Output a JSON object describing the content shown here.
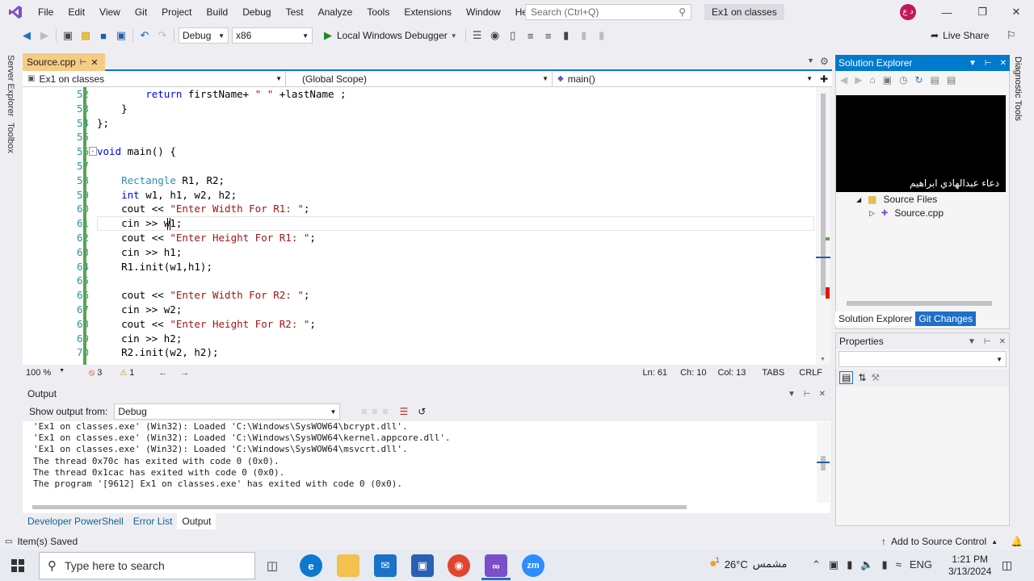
{
  "menu": [
    "File",
    "Edit",
    "View",
    "Git",
    "Project",
    "Build",
    "Debug",
    "Test",
    "Analyze",
    "Tools",
    "Extensions",
    "Window",
    "Help"
  ],
  "search": {
    "placeholder": "Search (Ctrl+Q)"
  },
  "solution_title": "Ex1 on classes",
  "avatar_initials": "د ع",
  "toolbar": {
    "config": "Debug",
    "platform": "x86",
    "run_label": "Local Windows Debugger",
    "live_share": "Live Share"
  },
  "left_rail": [
    "Server Explorer",
    "Toolbox"
  ],
  "right_rail": [
    "Diagnostic Tools"
  ],
  "editor": {
    "tab": "Source.cpp",
    "nav_project": "Ex1 on classes",
    "nav_scope": "(Global Scope)",
    "nav_member": "main()",
    "lines": [
      {
        "n": "52",
        "t": "        return firstName+ \" \" +lastName ;"
      },
      {
        "n": "53",
        "t": "    }"
      },
      {
        "n": "54",
        "t": "};"
      },
      {
        "n": "55",
        "t": ""
      },
      {
        "n": "56",
        "t": "void main() {"
      },
      {
        "n": "57",
        "t": ""
      },
      {
        "n": "58",
        "t": "    Rectangle R1, R2;"
      },
      {
        "n": "59",
        "t": "    int w1, h1, w2, h2;"
      },
      {
        "n": "60",
        "t": "    cout << \"Enter Width For R1: \";"
      },
      {
        "n": "61",
        "t": "    cin >> w1;"
      },
      {
        "n": "62",
        "t": "    cout << \"Enter Height For R1: \";"
      },
      {
        "n": "63",
        "t": "    cin >> h1;"
      },
      {
        "n": "64",
        "t": "    R1.init(w1,h1);"
      },
      {
        "n": "65",
        "t": ""
      },
      {
        "n": "66",
        "t": "    cout << \"Enter Width For R2: \";"
      },
      {
        "n": "67",
        "t": "    cin >> w2;"
      },
      {
        "n": "68",
        "t": "    cout << \"Enter Height For R2: \";"
      },
      {
        "n": "69",
        "t": "    cin >> h2;"
      },
      {
        "n": "70",
        "t": "    R2.init(w2, h2);"
      }
    ],
    "zoom": "100 %",
    "errors": "3",
    "warnings": "1",
    "position": {
      "ln": "Ln: 61",
      "ch": "Ch: 10",
      "col": "Col: 13",
      "tabs": "TABS",
      "eol": "CRLF"
    }
  },
  "output": {
    "title": "Output",
    "show_from_label": "Show output from:",
    "source": "Debug",
    "lines": [
      "'Ex1 on classes.exe' (Win32): Loaded 'C:\\Windows\\SysWOW64\\bcrypt.dll'.",
      "'Ex1 on classes.exe' (Win32): Loaded 'C:\\Windows\\SysWOW64\\kernel.appcore.dll'.",
      "'Ex1 on classes.exe' (Win32): Loaded 'C:\\Windows\\SysWOW64\\msvcrt.dll'.",
      "The thread 0x70c has exited with code 0 (0x0).",
      "The thread 0x1cac has exited with code 0 (0x0).",
      "The program '[9612] Ex1 on classes.exe' has exited with code 0 (0x0)."
    ]
  },
  "bottom_tabs": [
    "Developer PowerShell",
    "Error List",
    "Output"
  ],
  "solution_explorer": {
    "title": "Solution Explorer",
    "video_caption": "دعاء عبدالهادي ابراهيم",
    "tree": [
      "Source Files",
      "Source.cpp"
    ],
    "tabs": [
      "Solution Explorer",
      "Git Changes"
    ]
  },
  "properties": {
    "title": "Properties"
  },
  "status": {
    "left": "Item(s) Saved",
    "right": "Add to Source Control"
  },
  "taskbar": {
    "search_placeholder": "Type here to search",
    "weather": "26°C",
    "weather_label": "مشمس",
    "lang": "ENG",
    "time": "1:21 PM",
    "date": "3/13/2024",
    "weather_badge": "1"
  }
}
